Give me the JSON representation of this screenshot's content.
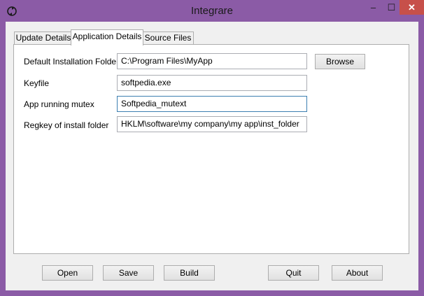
{
  "window": {
    "title": "Integrare",
    "minimize_glyph": "–",
    "maximize_glyph": "☐",
    "close_glyph": "✕"
  },
  "tabs": [
    {
      "label": "Update Details",
      "active": false
    },
    {
      "label": "Application Details",
      "active": true
    },
    {
      "label": "Source Files",
      "active": false
    }
  ],
  "form": {
    "default_folder_label": "Default Installation Folder",
    "default_folder_value": "C:\\Program Files\\MyApp",
    "browse_label": "Browse",
    "keyfile_label": "Keyfile",
    "keyfile_value": "softpedia.exe",
    "mutex_label": "App running mutex",
    "mutex_value": "Softpedia_mutext",
    "regkey_label": "Regkey of install folder",
    "regkey_value": "HKLM\\software\\my company\\my app\\inst_folder"
  },
  "buttons": {
    "open": "Open",
    "save": "Save",
    "build": "Build",
    "quit": "Quit",
    "about": "About"
  },
  "icons": {
    "app": "app-icon",
    "accent": "#8b5ba6",
    "close_color": "#c7504a"
  }
}
